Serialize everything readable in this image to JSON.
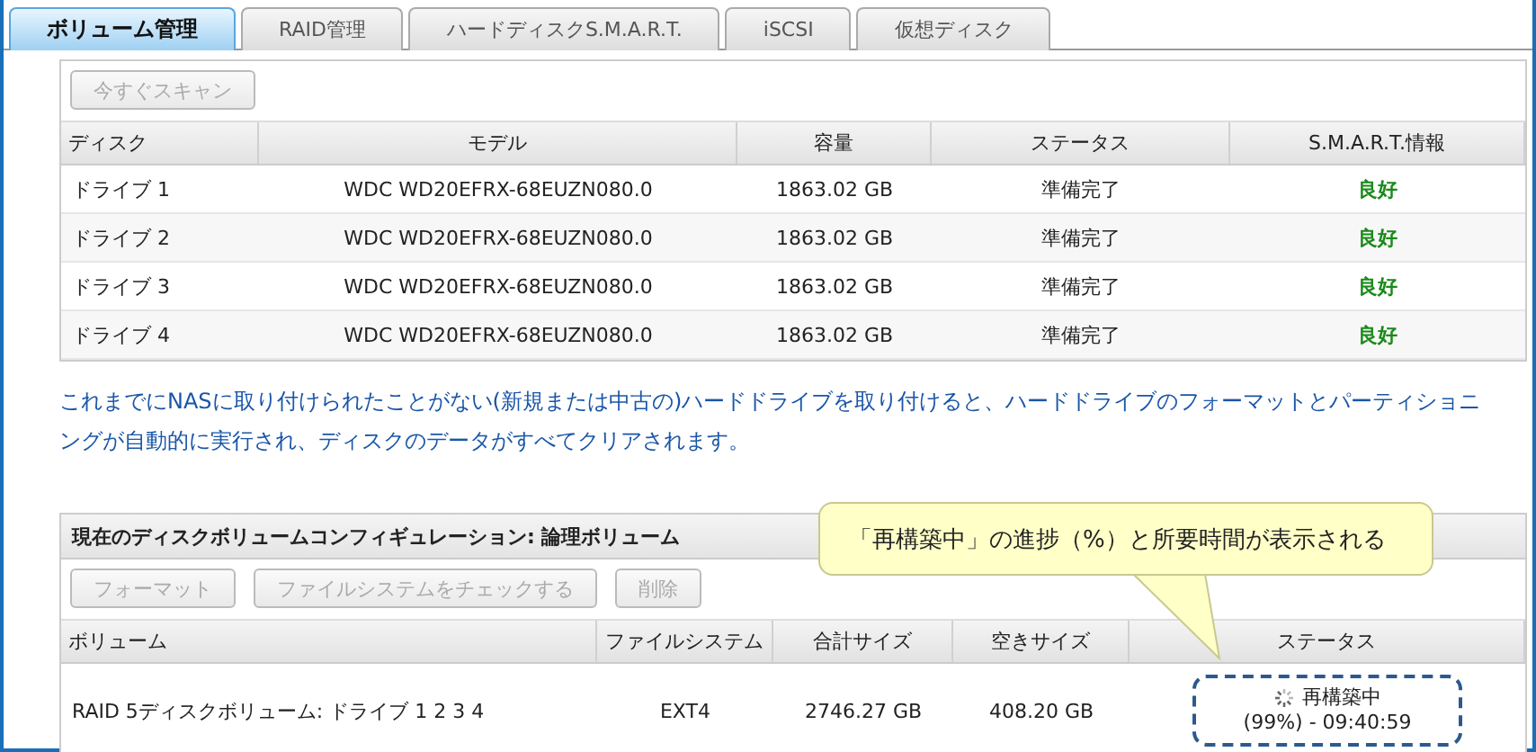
{
  "tabs": [
    {
      "label": "ボリューム管理",
      "selected": true
    },
    {
      "label": "RAID管理",
      "selected": false
    },
    {
      "label": "ハードディスクS.M.A.R.T.",
      "selected": false
    },
    {
      "label": "iSCSI",
      "selected": false
    },
    {
      "label": "仮想ディスク",
      "selected": false
    }
  ],
  "disk_panel": {
    "buttons": [
      {
        "label": "今すぐスキャン",
        "disabled": true
      }
    ],
    "columns": [
      "ディスク",
      "モデル",
      "容量",
      "ステータス",
      "S.M.A.R.T.情報"
    ],
    "rows": [
      [
        "ドライブ 1",
        "WDC WD20EFRX-68EUZN080.0",
        "1863.02 GB",
        "準備完了",
        "良好"
      ],
      [
        "ドライブ 2",
        "WDC WD20EFRX-68EUZN080.0",
        "1863.02 GB",
        "準備完了",
        "良好"
      ],
      [
        "ドライブ 3",
        "WDC WD20EFRX-68EUZN080.0",
        "1863.02 GB",
        "準備完了",
        "良好"
      ],
      [
        "ドライブ 4",
        "WDC WD20EFRX-68EUZN080.0",
        "1863.02 GB",
        "準備完了",
        "良好"
      ]
    ]
  },
  "notice": "これまでにNASに取り付けられたことがない(新規または中古の)ハードドライブを取り付けると、ハードドライブのフォーマットとパーティショニングが自動的に実行され、ディスクのデータがすべてクリアされます。",
  "volume_panel": {
    "title": "現在のディスクボリュームコンフィギュレーション: 論理ボリューム",
    "buttons": [
      {
        "label": "フォーマット",
        "disabled": true
      },
      {
        "label": "ファイルシステムをチェックする",
        "disabled": true
      },
      {
        "label": "削除",
        "disabled": true
      }
    ],
    "columns": [
      "ボリューム",
      "ファイルシステム",
      "合計サイズ",
      "空きサイズ",
      "ステータス"
    ],
    "rows": [
      {
        "volume": "RAID 5ディスクボリューム: ドライブ 1 2 3 4",
        "filesystem": "EXT4",
        "total": "2746.27 GB",
        "free": "408.20 GB",
        "status": "再構築中",
        "progress": "(99%) - 09:40:59"
      }
    ]
  },
  "callout": "「再構築中」の進捗（%）と所要時間が表示される"
}
